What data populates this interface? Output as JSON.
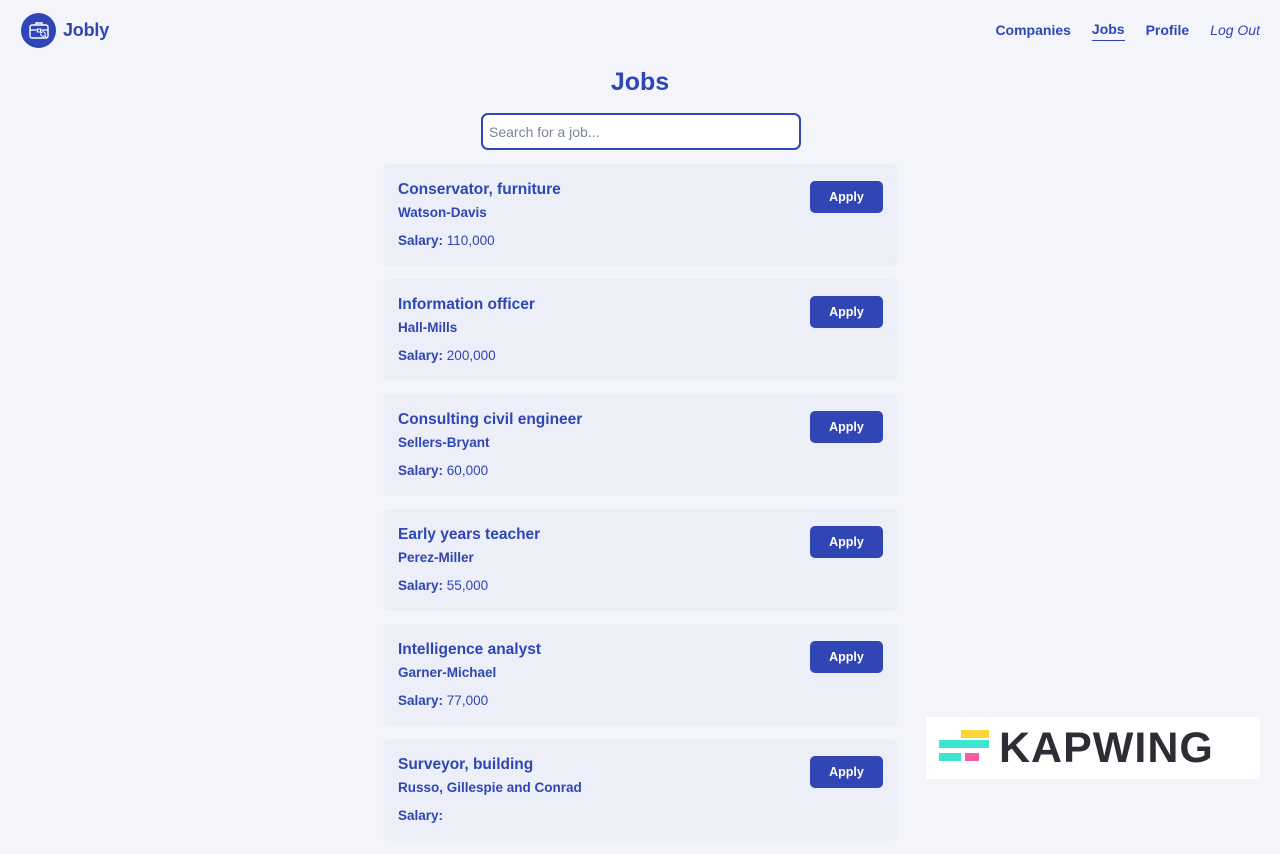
{
  "navbar": {
    "brand": "Jobly",
    "links": [
      "Companies",
      "Jobs",
      "Profile",
      "Log Out"
    ]
  },
  "page": {
    "title": "Jobs",
    "search_placeholder": "Search for a job..."
  },
  "jobs": [
    {
      "title": "Conservator, furniture",
      "company": "Watson-Davis",
      "salary_label": "Salary:",
      "salary": "110,000",
      "apply_label": "Apply"
    },
    {
      "title": "Information officer",
      "company": "Hall-Mills",
      "salary_label": "Salary:",
      "salary": "200,000",
      "apply_label": "Apply"
    },
    {
      "title": "Consulting civil engineer",
      "company": "Sellers-Bryant",
      "salary_label": "Salary:",
      "salary": "60,000",
      "apply_label": "Apply"
    },
    {
      "title": "Early years teacher",
      "company": "Perez-Miller",
      "salary_label": "Salary:",
      "salary": "55,000",
      "apply_label": "Apply"
    },
    {
      "title": "Intelligence analyst",
      "company": "Garner-Michael",
      "salary_label": "Salary:",
      "salary": "77,000",
      "apply_label": "Apply"
    },
    {
      "title": "Surveyor, building",
      "company": "Russo, Gillespie and Conrad",
      "salary_label": "Salary:",
      "salary": "",
      "apply_label": "Apply"
    }
  ],
  "watermark": {
    "text": "KAPWING"
  },
  "colors": {
    "primary": "#2f46b4",
    "background": "#f4f5fa",
    "card": "#eceef8"
  },
  "icons": {
    "brand": "briefcase-icon",
    "watermark": "kapwing-logo-icon"
  }
}
